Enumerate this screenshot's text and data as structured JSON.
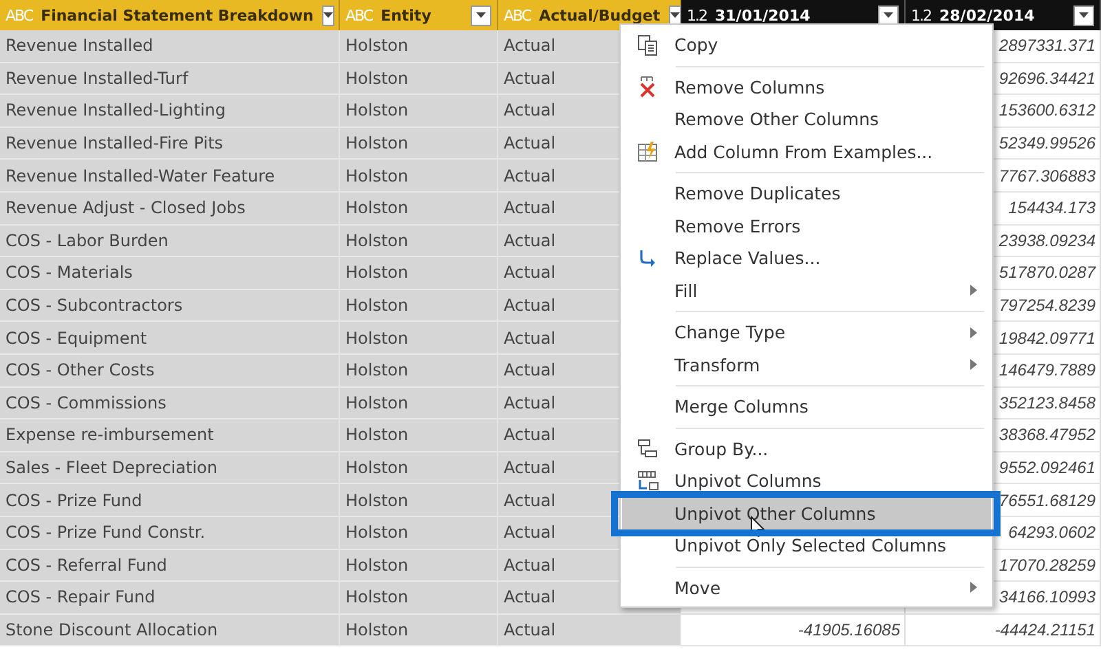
{
  "columns": [
    {
      "type": "ABC",
      "title": "Financial Statement Breakdown",
      "selected": true
    },
    {
      "type": "ABC",
      "title": "Entity",
      "selected": true
    },
    {
      "type": "ABC",
      "title": "Actual/Budget",
      "selected": true
    },
    {
      "type": "1.2",
      "title": "31/01/2014",
      "selected": false
    },
    {
      "type": "1.2",
      "title": "28/02/2014",
      "selected": false
    }
  ],
  "rows": [
    {
      "cells": [
        "Revenue Installed",
        "Holston",
        "Actual",
        "",
        "2897331.371"
      ]
    },
    {
      "cells": [
        "Revenue Installed-Turf",
        "Holston",
        "Actual",
        "",
        "92696.34421"
      ]
    },
    {
      "cells": [
        "Revenue Installed-Lighting",
        "Holston",
        "Actual",
        "",
        "153600.6312"
      ]
    },
    {
      "cells": [
        "Revenue Installed-Fire Pits",
        "Holston",
        "Actual",
        "",
        "52349.99526"
      ]
    },
    {
      "cells": [
        "Revenue Installed-Water Feature",
        "Holston",
        "Actual",
        "",
        "7767.306883"
      ]
    },
    {
      "cells": [
        "Revenue Adjust - Closed Jobs",
        "Holston",
        "Actual",
        "",
        "154434.173"
      ]
    },
    {
      "cells": [
        "COS - Labor Burden",
        "Holston",
        "Actual",
        "",
        "23938.09234"
      ]
    },
    {
      "cells": [
        "COS - Materials",
        "Holston",
        "Actual",
        "",
        "517870.0287"
      ]
    },
    {
      "cells": [
        "COS - Subcontractors",
        "Holston",
        "Actual",
        "",
        "797254.8239"
      ]
    },
    {
      "cells": [
        "COS - Equipment",
        "Holston",
        "Actual",
        "",
        "19842.09771"
      ]
    },
    {
      "cells": [
        "COS - Other Costs",
        "Holston",
        "Actual",
        "",
        "146479.7889"
      ]
    },
    {
      "cells": [
        "COS - Commissions",
        "Holston",
        "Actual",
        "",
        "352123.8458"
      ]
    },
    {
      "cells": [
        "Expense re-imbursement",
        "Holston",
        "Actual",
        "",
        "38368.47952"
      ]
    },
    {
      "cells": [
        "Sales - Fleet Depreciation",
        "Holston",
        "Actual",
        "",
        "9552.092461"
      ]
    },
    {
      "cells": [
        "COS - Prize Fund",
        "Holston",
        "Actual",
        "",
        "76551.68129"
      ]
    },
    {
      "cells": [
        "COS - Prize Fund Constr.",
        "Holston",
        "Actual",
        "",
        "64293.0602"
      ]
    },
    {
      "cells": [
        "COS - Referral Fund",
        "Holston",
        "Actual",
        "",
        "17070.28259"
      ]
    },
    {
      "cells": [
        "COS - Repair Fund",
        "Holston",
        "Actual",
        "",
        "34166.10993"
      ]
    },
    {
      "cells": [
        "Stone Discount Allocation",
        "Holston",
        "Actual",
        "-41905.16085",
        "-44424.21151"
      ]
    }
  ],
  "context_menu": {
    "items": [
      {
        "label": "Copy",
        "kind": "copy",
        "submenu": false,
        "selected": false,
        "separator_after": true
      },
      {
        "label": "Remove Columns",
        "kind": "remove",
        "submenu": false,
        "selected": false,
        "separator_after": false
      },
      {
        "label": "Remove Other Columns",
        "kind": "plain",
        "submenu": false,
        "selected": false,
        "separator_after": false
      },
      {
        "label": "Add Column From Examples...",
        "kind": "examples",
        "submenu": false,
        "selected": false,
        "separator_after": true
      },
      {
        "label": "Remove Duplicates",
        "kind": "plain",
        "submenu": false,
        "selected": false,
        "separator_after": false
      },
      {
        "label": "Remove Errors",
        "kind": "plain",
        "submenu": false,
        "selected": false,
        "separator_after": false
      },
      {
        "label": "Replace Values...",
        "kind": "replace",
        "submenu": false,
        "selected": false,
        "separator_after": false
      },
      {
        "label": "Fill",
        "kind": "plain",
        "submenu": true,
        "selected": false,
        "separator_after": true
      },
      {
        "label": "Change Type",
        "kind": "plain",
        "submenu": true,
        "selected": false,
        "separator_after": false
      },
      {
        "label": "Transform",
        "kind": "plain",
        "submenu": true,
        "selected": false,
        "separator_after": true
      },
      {
        "label": "Merge Columns",
        "kind": "plain",
        "submenu": false,
        "selected": false,
        "separator_after": true
      },
      {
        "label": "Group By...",
        "kind": "group",
        "submenu": false,
        "selected": false,
        "separator_after": false
      },
      {
        "label": "Unpivot Columns",
        "kind": "unpivot",
        "submenu": false,
        "selected": false,
        "separator_after": false
      },
      {
        "label": "Unpivot Other Columns",
        "kind": "plain",
        "submenu": false,
        "selected": true,
        "separator_after": false
      },
      {
        "label": "Unpivot Only Selected Columns",
        "kind": "plain",
        "submenu": false,
        "selected": false,
        "separator_after": true
      },
      {
        "label": "Move",
        "kind": "plain",
        "submenu": true,
        "selected": false,
        "separator_after": false
      }
    ]
  }
}
